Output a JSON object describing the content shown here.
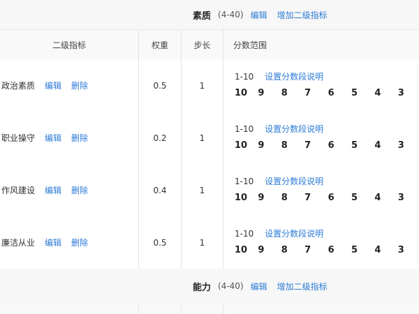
{
  "section1": {
    "name": "素质",
    "range": "(4-40)",
    "edit_label": "编辑",
    "add_label": "增加二级指标"
  },
  "columns": {
    "indicator": "二级指标",
    "weight": "权重",
    "step": "步长",
    "score_range": "分数范围"
  },
  "rows": [
    {
      "name": "政治素质",
      "edit": "编辑",
      "delete": "删除",
      "weight": "0.5",
      "step": "1",
      "range": "1-10",
      "set_label": "设置分数段说明",
      "scores": [
        "10",
        "9",
        "8",
        "7",
        "6",
        "5",
        "4",
        "3"
      ]
    },
    {
      "name": "职业操守",
      "edit": "编辑",
      "delete": "删除",
      "weight": "0.2",
      "step": "1",
      "range": "1-10",
      "set_label": "设置分数段说明",
      "scores": [
        "10",
        "9",
        "8",
        "7",
        "6",
        "5",
        "4",
        "3"
      ]
    },
    {
      "name": "作风建设",
      "edit": "编辑",
      "delete": "删除",
      "weight": "0.4",
      "step": "1",
      "range": "1-10",
      "set_label": "设置分数段说明",
      "scores": [
        "10",
        "9",
        "8",
        "7",
        "6",
        "5",
        "4",
        "3"
      ]
    },
    {
      "name": "廉洁从业",
      "edit": "编辑",
      "delete": "删除",
      "weight": "0.5",
      "step": "1",
      "range": "1-10",
      "set_label": "设置分数段说明",
      "scores": [
        "10",
        "9",
        "8",
        "7",
        "6",
        "5",
        "4",
        "3"
      ]
    }
  ],
  "section2": {
    "name": "能力",
    "range": "(4-40)",
    "edit_label": "编辑",
    "add_label": "增加二级指标"
  }
}
